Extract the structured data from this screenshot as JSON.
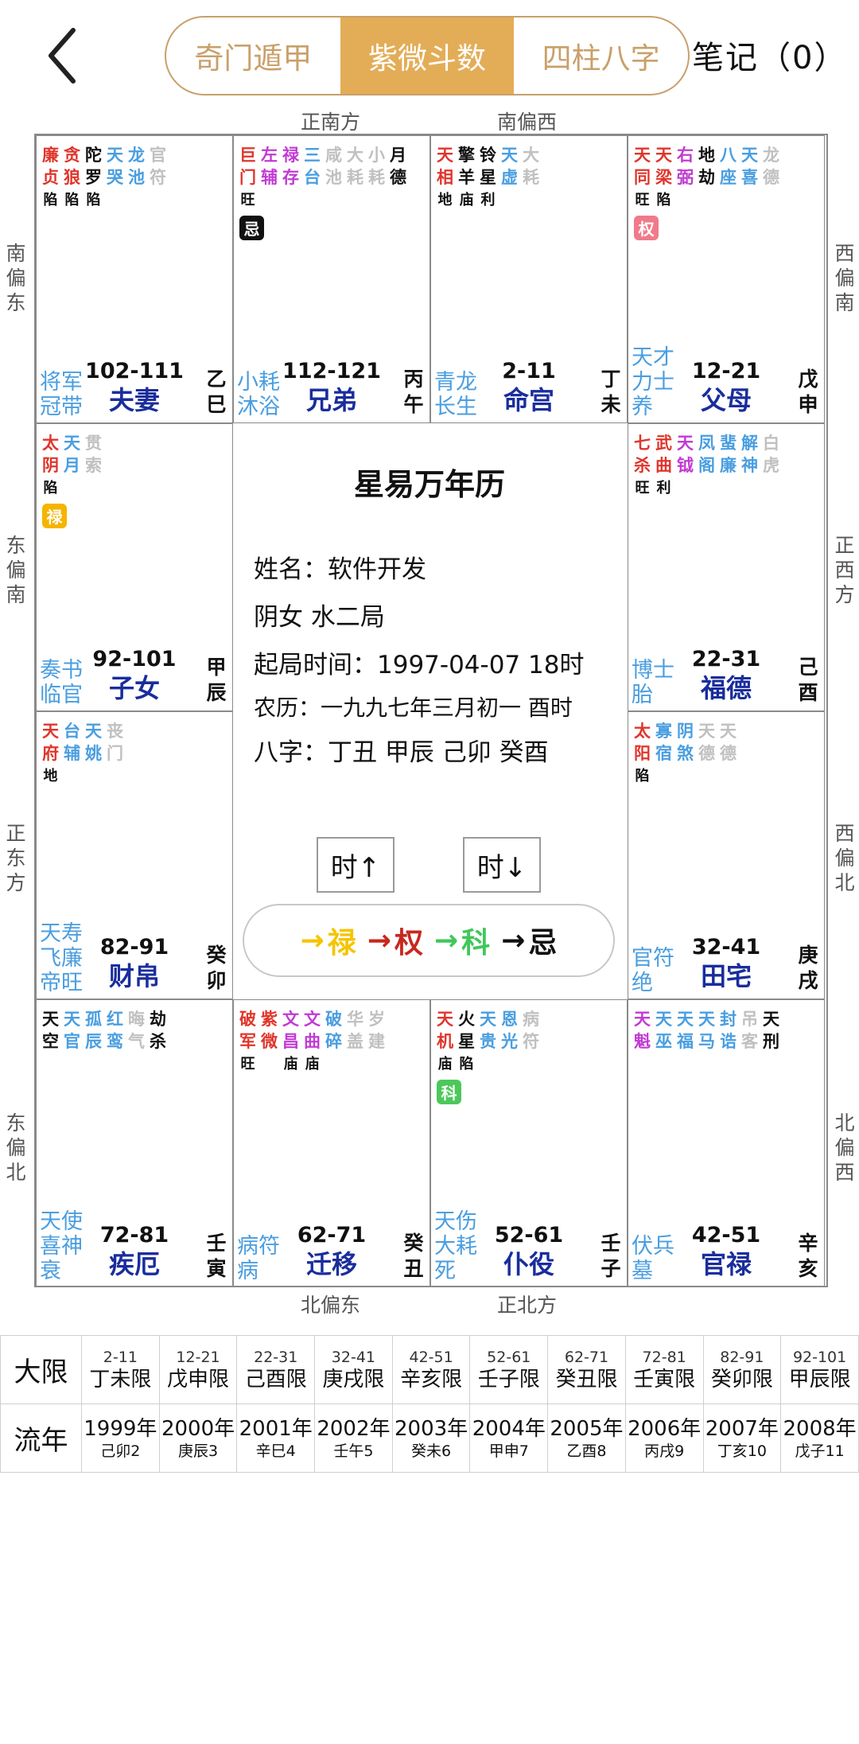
{
  "header": {
    "tabs": [
      "奇门遁甲",
      "紫微斗数",
      "四柱八字"
    ],
    "active_tab": 1,
    "notes": "笔记（0）"
  },
  "directions": {
    "top_left": "正南方",
    "top_right": "南偏西",
    "bottom_left": "北偏东",
    "bottom_right": "正北方",
    "left": [
      "南偏东",
      "东偏南",
      "正东方",
      "东偏北"
    ],
    "right": [
      "西偏南",
      "正西方",
      "西偏北",
      "北偏西"
    ]
  },
  "palaces": [
    {
      "id": "fuqi",
      "stars": [
        {
          "t": "廉贞",
          "c": "red",
          "b": "陷"
        },
        {
          "t": "贪狼",
          "c": "red",
          "b": "陷"
        },
        {
          "t": "陀罗",
          "c": "black",
          "b": "陷"
        },
        {
          "t": "天哭",
          "c": "blue",
          "b": ""
        },
        {
          "t": "龙池",
          "c": "blue",
          "b": ""
        },
        {
          "t": "官符",
          "c": "gray",
          "b": ""
        }
      ],
      "badge": null,
      "deities": [
        "将军",
        "冠带"
      ],
      "age": "102-111",
      "palace": "夫妻",
      "gz": "乙巳"
    },
    {
      "id": "xiongdi",
      "stars": [
        {
          "t": "巨门",
          "c": "red",
          "b": "旺"
        },
        {
          "t": "左辅",
          "c": "purple",
          "b": ""
        },
        {
          "t": "禄存",
          "c": "purple",
          "b": ""
        },
        {
          "t": "三台",
          "c": "blue",
          "b": ""
        },
        {
          "t": "咸池",
          "c": "gray",
          "b": ""
        },
        {
          "t": "大耗",
          "c": "gray",
          "b": ""
        },
        {
          "t": "小耗",
          "c": "gray",
          "b": ""
        },
        {
          "t": "月德",
          "c": "black",
          "b": ""
        }
      ],
      "badge": {
        "text": "忌",
        "color": "#111111"
      },
      "deities": [
        "小耗",
        "沐浴"
      ],
      "age": "112-121",
      "palace": "兄弟",
      "gz": "丙午"
    },
    {
      "id": "minggong",
      "stars": [
        {
          "t": "天相",
          "c": "red",
          "b": "地"
        },
        {
          "t": "擎羊",
          "c": "black",
          "b": "庙"
        },
        {
          "t": "铃星",
          "c": "black",
          "b": "利"
        },
        {
          "t": "天虚",
          "c": "blue",
          "b": ""
        },
        {
          "t": "大耗",
          "c": "gray",
          "b": ""
        }
      ],
      "badge": null,
      "deities": [
        "青龙",
        "长生"
      ],
      "age": "2-11",
      "palace": "命宫",
      "gz": "丁未"
    },
    {
      "id": "fumu",
      "stars": [
        {
          "t": "天同",
          "c": "red",
          "b": "旺"
        },
        {
          "t": "天梁",
          "c": "red",
          "b": "陷"
        },
        {
          "t": "右弼",
          "c": "purple",
          "b": ""
        },
        {
          "t": "地劫",
          "c": "black",
          "b": ""
        },
        {
          "t": "八座",
          "c": "blue",
          "b": ""
        },
        {
          "t": "天喜",
          "c": "blue",
          "b": ""
        },
        {
          "t": "龙德",
          "c": "gray",
          "b": ""
        }
      ],
      "badge": {
        "text": "权",
        "color": "#f07a8a"
      },
      "deities": [
        "天才",
        "力士",
        "养"
      ],
      "age": "12-21",
      "palace": "父母",
      "gz": "戊申"
    },
    {
      "id": "zinv",
      "stars": [
        {
          "t": "太阴",
          "c": "red",
          "b": "陷"
        },
        {
          "t": "天月",
          "c": "blue",
          "b": ""
        },
        {
          "t": "贯索",
          "c": "gray",
          "b": ""
        }
      ],
      "badge": {
        "text": "禄",
        "color": "#f5b400"
      },
      "deities": [
        "奏书",
        "临官"
      ],
      "age": "92-101",
      "palace": "子女",
      "gz": "甲辰"
    },
    {
      "id": "fude",
      "stars": [
        {
          "t": "七杀",
          "c": "red",
          "b": "旺"
        },
        {
          "t": "武曲",
          "c": "red",
          "b": "利"
        },
        {
          "t": "天钺",
          "c": "purple",
          "b": ""
        },
        {
          "t": "凤阁",
          "c": "blue",
          "b": ""
        },
        {
          "t": "蜚廉",
          "c": "blue",
          "b": ""
        },
        {
          "t": "解神",
          "c": "blue",
          "b": ""
        },
        {
          "t": "白虎",
          "c": "gray",
          "b": ""
        }
      ],
      "badge": null,
      "deities": [
        "博士",
        "胎"
      ],
      "age": "22-31",
      "palace": "福德",
      "gz": "己酉"
    },
    {
      "id": "caibo",
      "stars": [
        {
          "t": "天府",
          "c": "red",
          "b": "地"
        },
        {
          "t": "台辅",
          "c": "blue",
          "b": ""
        },
        {
          "t": "天姚",
          "c": "blue",
          "b": ""
        },
        {
          "t": "丧门",
          "c": "gray",
          "b": ""
        }
      ],
      "badge": null,
      "deities": [
        "天寿",
        "飞廉",
        "帝旺"
      ],
      "age": "82-91",
      "palace": "财帛",
      "gz": "癸卯"
    },
    {
      "id": "tianzhai",
      "stars": [
        {
          "t": "太阳",
          "c": "red",
          "b": "陷"
        },
        {
          "t": "寡宿",
          "c": "blue",
          "b": ""
        },
        {
          "t": "阴煞",
          "c": "blue",
          "b": ""
        },
        {
          "t": "天德",
          "c": "gray",
          "b": ""
        },
        {
          "t": "天德",
          "c": "gray",
          "b": ""
        }
      ],
      "badge": null,
      "deities": [
        "官符",
        "绝"
      ],
      "age": "32-41",
      "palace": "田宅",
      "gz": "庚戌"
    },
    {
      "id": "jie",
      "stars": [
        {
          "t": "天空",
          "c": "black",
          "b": ""
        },
        {
          "t": "天官",
          "c": "blue",
          "b": ""
        },
        {
          "t": "孤辰",
          "c": "blue",
          "b": ""
        },
        {
          "t": "红鸾",
          "c": "blue",
          "b": ""
        },
        {
          "t": "晦气",
          "c": "gray",
          "b": ""
        },
        {
          "t": "劫杀",
          "c": "black",
          "b": ""
        }
      ],
      "badge": null,
      "deities": [
        "天使",
        "喜神",
        "衰"
      ],
      "age": "72-81",
      "palace": "疾厄",
      "gz": "壬寅"
    },
    {
      "id": "qianyi",
      "stars": [
        {
          "t": "破军",
          "c": "red",
          "b": "旺"
        },
        {
          "t": "紫微",
          "c": "red",
          "b": ""
        },
        {
          "t": "文昌",
          "c": "purple",
          "b": "庙"
        },
        {
          "t": "文曲",
          "c": "purple",
          "b": "庙"
        },
        {
          "t": "破碎",
          "c": "blue",
          "b": ""
        },
        {
          "t": "华盖",
          "c": "gray",
          "b": ""
        },
        {
          "t": "岁建",
          "c": "gray",
          "b": ""
        }
      ],
      "badge": null,
      "deities": [
        "病符",
        "病"
      ],
      "age": "62-71",
      "palace": "迁移",
      "gz": "癸丑"
    },
    {
      "id": "puyi",
      "stars": [
        {
          "t": "天机",
          "c": "red",
          "b": "庙"
        },
        {
          "t": "火星",
          "c": "black",
          "b": "陷"
        },
        {
          "t": "天贵",
          "c": "blue",
          "b": ""
        },
        {
          "t": "恩光",
          "c": "blue",
          "b": ""
        },
        {
          "t": "病符",
          "c": "gray",
          "b": ""
        }
      ],
      "badge": {
        "text": "科",
        "color": "#4cc85a"
      },
      "deities": [
        "天伤",
        "大耗",
        "死"
      ],
      "age": "52-61",
      "palace": "仆役",
      "gz": "壬子"
    },
    {
      "id": "guanlu",
      "stars": [
        {
          "t": "天魁",
          "c": "purple",
          "b": ""
        },
        {
          "t": "天巫",
          "c": "blue",
          "b": ""
        },
        {
          "t": "天福",
          "c": "blue",
          "b": ""
        },
        {
          "t": "天马",
          "c": "blue",
          "b": ""
        },
        {
          "t": "封诰",
          "c": "blue",
          "b": ""
        },
        {
          "t": "吊客",
          "c": "gray",
          "b": ""
        },
        {
          "t": "天刑",
          "c": "black",
          "b": ""
        }
      ],
      "badge": null,
      "deities": [
        "伏兵",
        "墓"
      ],
      "age": "42-51",
      "palace": "官禄",
      "gz": "辛亥"
    }
  ],
  "center": {
    "title": "星易万年历",
    "name": "姓名：软件开发",
    "gender": "阴女 水二局",
    "start": "起局时间：1997-04-07 18时",
    "lunar": "农历：一九九七年三月初一 酉时",
    "bazi": "八字：丁丑 甲辰 己卯 癸酉",
    "hour_up": "时↑",
    "hour_down": "时↓",
    "sihua": [
      {
        "arrow": "→",
        "label": "禄",
        "color": "#f5c400"
      },
      {
        "arrow": "→",
        "label": "权",
        "color": "#c8281e"
      },
      {
        "arrow": "→",
        "label": "科",
        "color": "#3ec85a"
      },
      {
        "arrow": "→",
        "label": "忌",
        "color": "#111111"
      }
    ]
  },
  "table": {
    "daxian_head": "大限",
    "liunian_head": "流年",
    "daxian": [
      {
        "range": "2-11",
        "label": "丁未限"
      },
      {
        "range": "12-21",
        "label": "戊申限"
      },
      {
        "range": "22-31",
        "label": "己酉限"
      },
      {
        "range": "32-41",
        "label": "庚戌限"
      },
      {
        "range": "42-51",
        "label": "辛亥限"
      },
      {
        "range": "52-61",
        "label": "壬子限"
      },
      {
        "range": "62-71",
        "label": "癸丑限"
      },
      {
        "range": "72-81",
        "label": "壬寅限"
      },
      {
        "range": "82-91",
        "label": "癸卯限"
      },
      {
        "range": "92-101",
        "label": "甲辰限"
      }
    ],
    "liunian": [
      {
        "year": "1999年",
        "gz": "己卯2"
      },
      {
        "year": "2000年",
        "gz": "庚辰3"
      },
      {
        "year": "2001年",
        "gz": "辛巳4"
      },
      {
        "year": "2002年",
        "gz": "壬午5"
      },
      {
        "year": "2003年",
        "gz": "癸未6"
      },
      {
        "year": "2004年",
        "gz": "甲申7"
      },
      {
        "year": "2005年",
        "gz": "乙酉8"
      },
      {
        "year": "2006年",
        "gz": "丙戌9"
      },
      {
        "year": "2007年",
        "gz": "丁亥10"
      },
      {
        "year": "2008年",
        "gz": "戊子11"
      }
    ]
  }
}
